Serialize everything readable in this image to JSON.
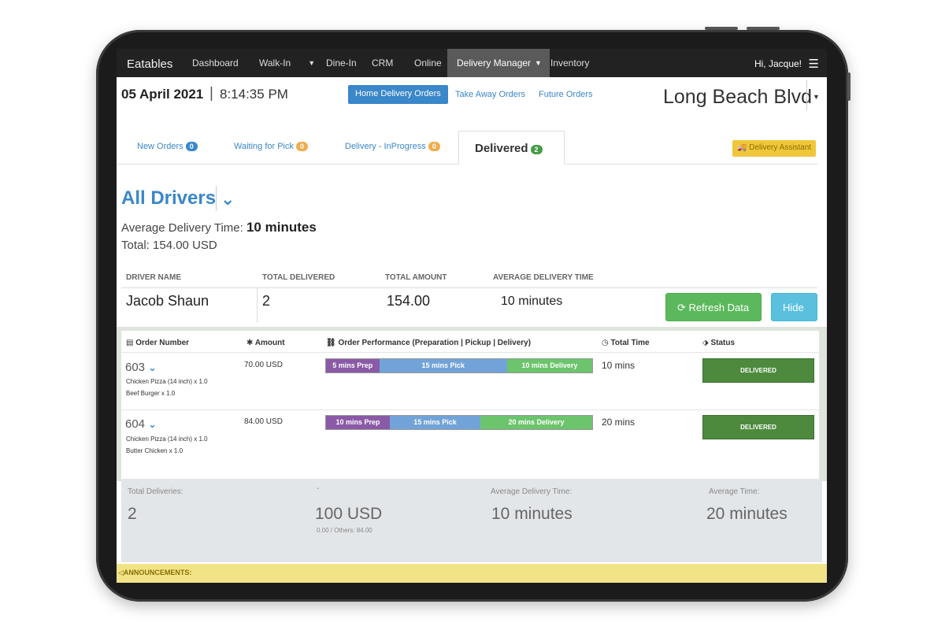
{
  "nav": {
    "brand": "Eatables",
    "items": [
      "Dashboard",
      "Walk-In",
      "Dine-In",
      "CRM",
      "Online",
      "Delivery Manager",
      "Inventory"
    ],
    "greeting": "Hi, Jacque!"
  },
  "header": {
    "date": "05 April 2021",
    "separator": "|",
    "time": "8:14:35 PM",
    "order_types": [
      "Home Delivery Orders",
      "Take Away Orders",
      "Future Orders"
    ],
    "location": "Long Beach Blvd"
  },
  "tabs": [
    {
      "label": "New Orders",
      "count": "0"
    },
    {
      "label": "Waiting for Pick",
      "count": "0"
    },
    {
      "label": "Delivery - InProgress",
      "count": "0"
    },
    {
      "label": "Delivered",
      "count": "2"
    }
  ],
  "delivery_assistant": "Delivery Assistant",
  "drivers": {
    "title": "All Drivers",
    "avg_label": "Average Delivery Time:",
    "avg_value": "10 minutes",
    "total": "Total: 154.00 USD"
  },
  "driver_table": {
    "headers": [
      "DRIVER NAME",
      "TOTAL DELIVERED",
      "TOTAL AMOUNT",
      "AVERAGE DELIVERY TIME"
    ],
    "row": {
      "name": "Jacob Shaun",
      "delivered": "2",
      "amount": "154.00",
      "avg_time": "10 minutes"
    },
    "refresh": "Refresh Data",
    "hide": "Hide"
  },
  "orders_table": {
    "headers": [
      "Order Number",
      "Amount",
      "Order Performance (Preparation | Pickup | Delivery)",
      "Total Time",
      "Status"
    ],
    "rows": [
      {
        "number": "603",
        "items": [
          "Chicken Pizza (14 inch) x 1.0",
          "Beef Burger x 1.0"
        ],
        "amount": "70.00 USD",
        "prep": "5 mins Prep",
        "pick": "15 mins Pick",
        "delivery": "10 mins Delivery",
        "total_time": "10 mins",
        "status": "DELIVERED"
      },
      {
        "number": "604",
        "items": [
          "Chicken Pizza (14 inch) x 1.0",
          "Butter Chicken x 1.0"
        ],
        "amount": "84.00 USD",
        "prep": "10 mins Prep",
        "pick": "15 mins Pick",
        "delivery": "20 mins Delivery",
        "total_time": "20 mins",
        "status": "DELIVERED"
      }
    ]
  },
  "summary": {
    "total_deliveries_label": "Total Deliveries:",
    "total_deliveries": "2",
    "amount_label": "-",
    "amount": "100 USD",
    "amount_sub": "0.00 / Others: 84.00",
    "avg_delivery_label": "Average Delivery Time:",
    "avg_delivery": "10 minutes",
    "avg_time_label": "Average Time:",
    "avg_time": "20 minutes"
  },
  "announcements": "ANNOUNCEMENTS:"
}
